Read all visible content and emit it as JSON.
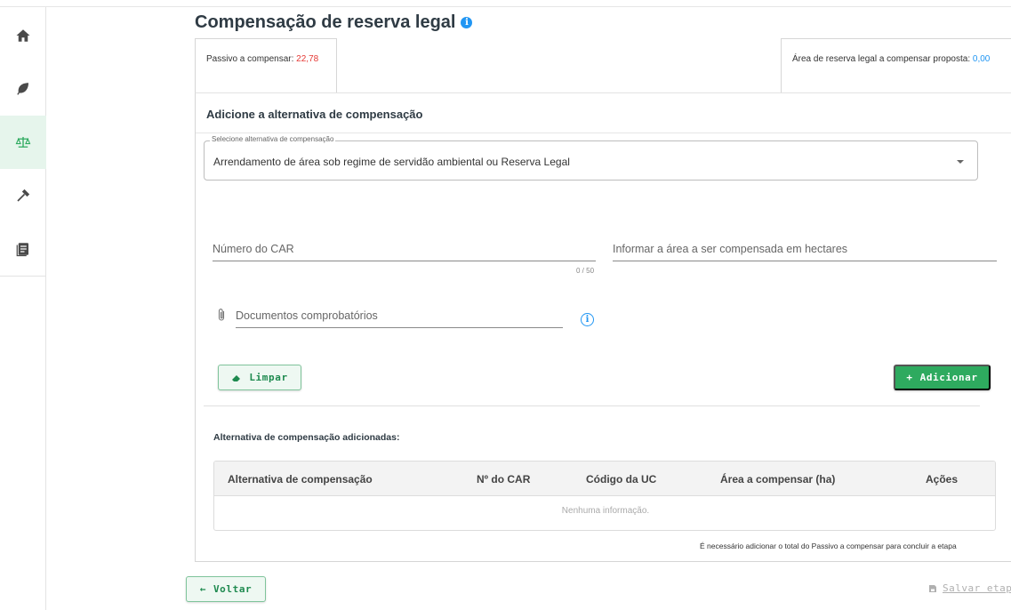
{
  "page": {
    "title": "Compensação de reserva legal",
    "info_icon": "i"
  },
  "summary": {
    "passivo_label": "Passivo a compensar:",
    "passivo_value": "22,78",
    "area_label": "Área de reserva legal a compensar proposta:",
    "area_value": "0,00"
  },
  "form": {
    "heading": "Adicione a alternativa de compensação",
    "select_label": "Selecione alternativa de compensação",
    "select_value": "Arrendamento de área sob regime de servidão ambiental ou Reserva Legal",
    "car_placeholder": "Número do CAR",
    "car_counter": "0 / 50",
    "area_placeholder": "Informar a área a ser compensada em hectares",
    "docs_placeholder": "Documentos comprobatórios",
    "clear_label": "Limpar",
    "add_label": "Adicionar"
  },
  "list": {
    "title": "Alternativa de compensação adicionadas:",
    "columns": [
      "Alternativa de compensação",
      "Nº do CAR",
      "Código da UC",
      "Área a compensar (ha)",
      "Ações"
    ],
    "empty_text": "Nenhuma informação.",
    "note": "É necessário adicionar o total do Passivo a compensar para concluir a etapa"
  },
  "footer": {
    "back_label": "Voltar",
    "save_label": "Salvar etapa"
  },
  "colors": {
    "accent": "#2eaa5f",
    "info": "#2196f3",
    "danger": "#e53935"
  },
  "icons": {
    "sidebar": [
      "home-icon",
      "leaf-icon",
      "scale-icon",
      "hammer-icon",
      "document-icon"
    ]
  }
}
